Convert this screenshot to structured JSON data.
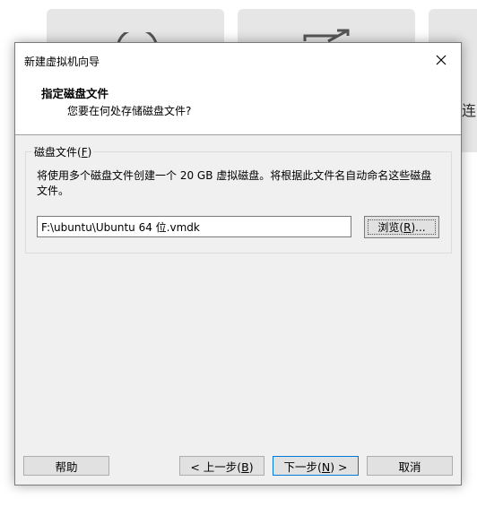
{
  "background": {
    "right_tile_text": "连"
  },
  "dialog": {
    "title": "新建虚拟机向导",
    "header": {
      "title": "指定磁盘文件",
      "subtitle": "您要在何处存储磁盘文件?"
    },
    "disk_file_group": {
      "label_text": "磁盘文件",
      "label_paren_open": "(",
      "label_mnemonic": "F",
      "label_paren_close": ")",
      "description": "将使用多个磁盘文件创建一个 20 GB 虚拟磁盘。将根据此文件名自动命名这些磁盘文件。",
      "path_value": "F:\\ubuntu\\Ubuntu 64 位.vmdk",
      "browse": {
        "text": "浏览",
        "paren_open": "(",
        "mnemonic": "R",
        "paren_close": ")...",
        "label": "浏览(R)..."
      }
    },
    "buttons": {
      "help": "帮助",
      "back_prefix": "< 上一步(",
      "back_mnemonic": "B",
      "back_suffix": ")",
      "next_prefix": "下一步(",
      "next_mnemonic": "N",
      "next_suffix": ") >",
      "cancel": "取消"
    }
  }
}
